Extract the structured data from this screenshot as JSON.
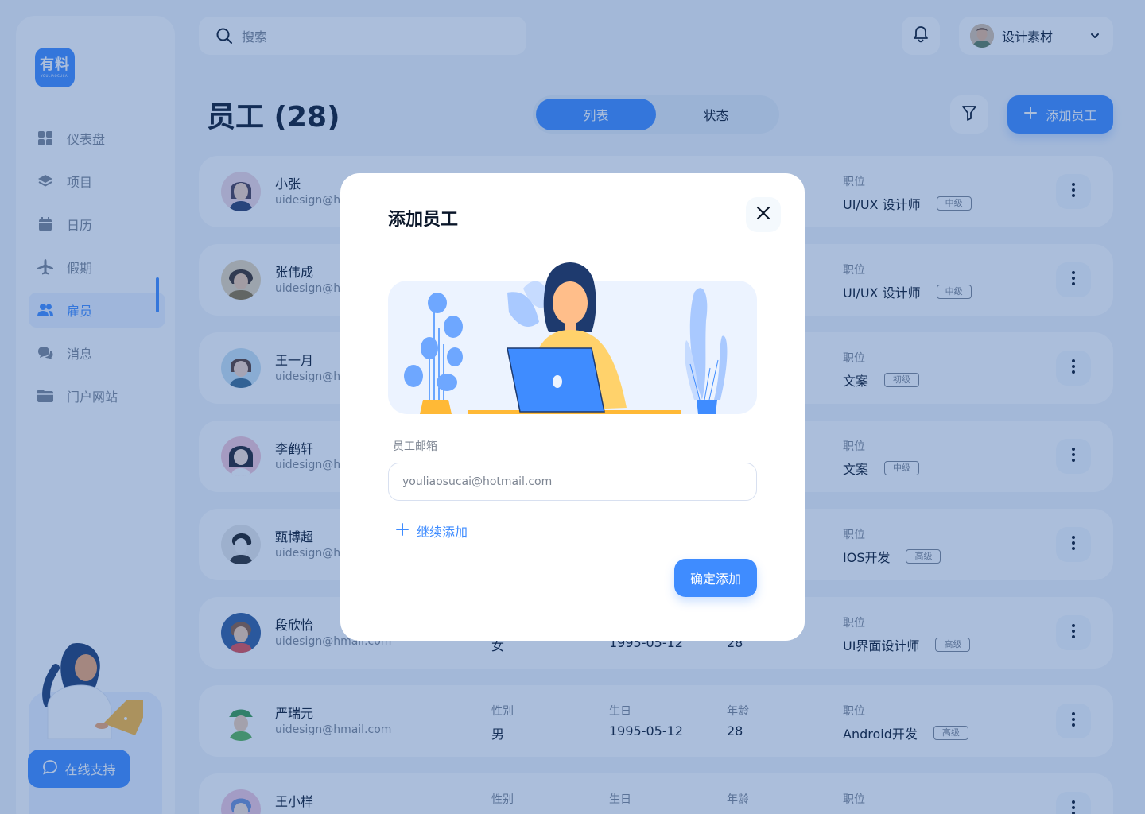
{
  "brand": {
    "logo_text": "有料",
    "logo_subtext": "YOULIAOSUCAI"
  },
  "sidebar": {
    "items": [
      {
        "label": "仪表盘",
        "icon": "dashboard-icon"
      },
      {
        "label": "项目",
        "icon": "layers-icon"
      },
      {
        "label": "日历",
        "icon": "calendar-icon"
      },
      {
        "label": "假期",
        "icon": "airplane-icon"
      },
      {
        "label": "雇员",
        "icon": "users-icon",
        "active": true
      },
      {
        "label": "消息",
        "icon": "chat-icon"
      },
      {
        "label": "门户网站",
        "icon": "folder-icon"
      }
    ],
    "support_label": "在线支持"
  },
  "header": {
    "search_placeholder": "搜索",
    "user_name": "设计素材"
  },
  "page": {
    "title": "员工 (28)",
    "view_tabs": [
      "列表",
      "状态"
    ],
    "add_button": "添加员工"
  },
  "columns": {
    "gender": "性别",
    "birthday": "生日",
    "age": "年龄",
    "position": "职位"
  },
  "employees": [
    {
      "name": "小张",
      "email": "uidesign@hm",
      "position": "UI/UX 设计师",
      "level": "中级"
    },
    {
      "name": "张伟成",
      "email": "uidesign@hm",
      "position": "UI/UX 设计师",
      "level": "中级"
    },
    {
      "name": "王一月",
      "email": "uidesign@hm",
      "position": "文案",
      "level": "初级"
    },
    {
      "name": "李鹤轩",
      "email": "uidesign@hm",
      "position": "文案",
      "level": "中级"
    },
    {
      "name": "甄博超",
      "email": "uidesign@hm",
      "position": "IOS开发",
      "level": "高级"
    },
    {
      "name": "段欣怡",
      "email": "uidesign@hmail.com",
      "gender": "女",
      "birthday": "1995-05-12",
      "age": "28",
      "position": "UI界面设计师",
      "level": "高级"
    },
    {
      "name": "严瑞元",
      "email": "uidesign@hmail.com",
      "gender": "男",
      "birthday": "1995-05-12",
      "age": "28",
      "position": "Android开发",
      "level": "高级"
    },
    {
      "name": "王小样",
      "email": "",
      "gender": "",
      "birthday": "",
      "age": "",
      "position": "",
      "level": ""
    }
  ],
  "modal": {
    "title": "添加员工",
    "email_label": "员工邮箱",
    "email_value": "youliaosucai@hotmail.com",
    "add_more": "继续添加",
    "confirm": "确定添加"
  },
  "colors": {
    "primary": "#3f8cff",
    "background": "#f3f6fb",
    "text": "#0a1629",
    "muted": "#7d8592"
  }
}
